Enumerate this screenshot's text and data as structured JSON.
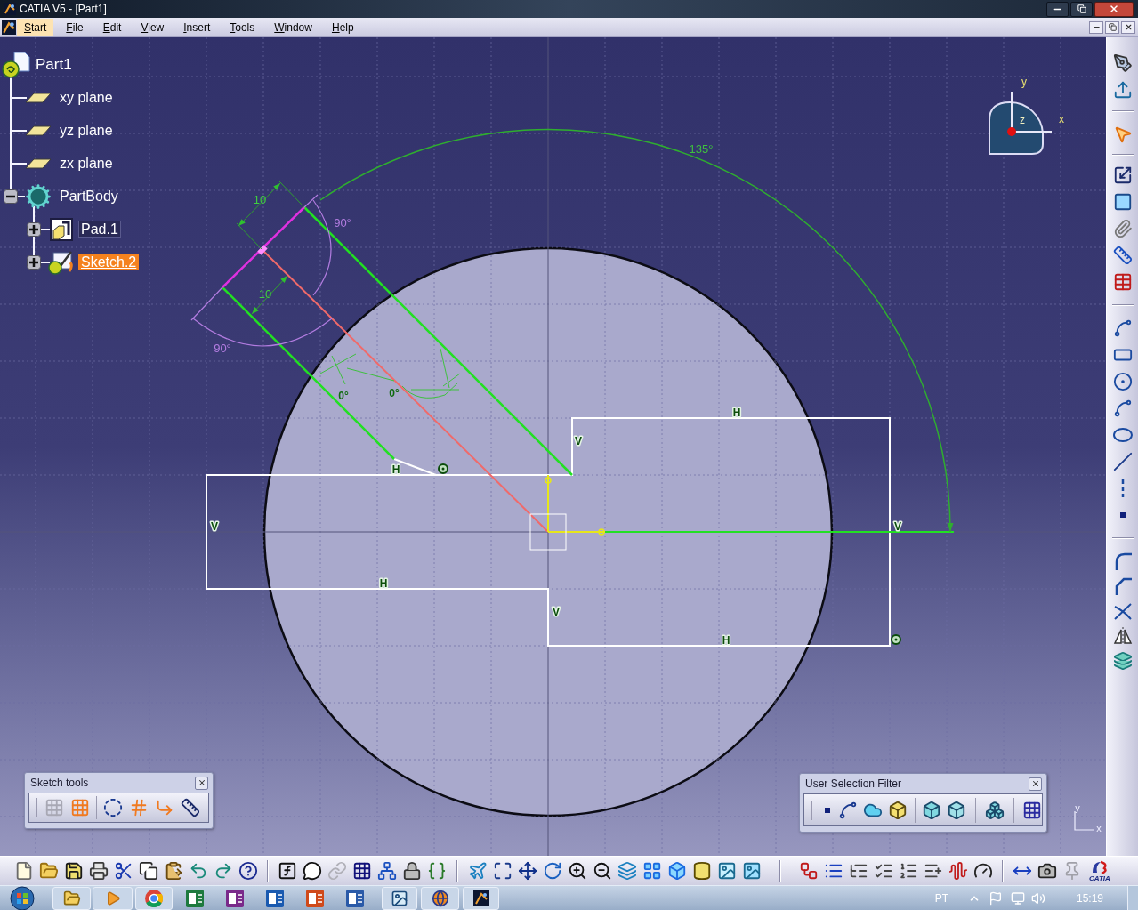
{
  "window": {
    "title": "CATIA V5 - [Part1]"
  },
  "menu": [
    {
      "label": "Start",
      "selected": true
    },
    {
      "label": "File",
      "selected": false
    },
    {
      "label": "Edit",
      "selected": false
    },
    {
      "label": "View",
      "selected": false
    },
    {
      "label": "Insert",
      "selected": false
    },
    {
      "label": "Tools",
      "selected": false
    },
    {
      "label": "Window",
      "selected": false
    },
    {
      "label": "Help",
      "selected": false
    }
  ],
  "tree": {
    "label": "Part1",
    "kind": "part",
    "selected": false,
    "children": [
      {
        "label": "xy plane",
        "kind": "plane",
        "selected": false
      },
      {
        "label": "yz plane",
        "kind": "plane",
        "selected": false
      },
      {
        "label": "zx plane",
        "kind": "plane",
        "selected": false
      },
      {
        "label": "PartBody",
        "kind": "body",
        "selected": false,
        "expanded": true,
        "children": [
          {
            "label": "Pad.1",
            "kind": "pad",
            "selected": false,
            "highlighted": true,
            "in_work": false,
            "expanded": false
          },
          {
            "label": "Sketch.2",
            "kind": "sketch",
            "selected": true,
            "highlighted": false,
            "in_work": true,
            "expanded": false
          }
        ]
      }
    ]
  },
  "sketch": {
    "angle_labels": [
      "135°",
      "90°",
      "90°"
    ],
    "length_labels": [
      "10",
      "10"
    ],
    "parallel_labels": [
      "0°",
      "0°"
    ],
    "constraint_labels": [
      "H",
      "V",
      "H",
      "V",
      "V",
      "H",
      "V",
      "H"
    ]
  },
  "compass": {
    "labels": [
      "y",
      "z",
      "x"
    ]
  },
  "sketch_tools": {
    "title": "Sketch tools"
  },
  "selection_filter": {
    "title": "User Selection Filter"
  },
  "axis_triad": {
    "labels": [
      "y",
      "x"
    ]
  },
  "logo": {
    "text": "CATIA"
  },
  "taskbar": {
    "language": "PT",
    "clock": "15:19"
  }
}
